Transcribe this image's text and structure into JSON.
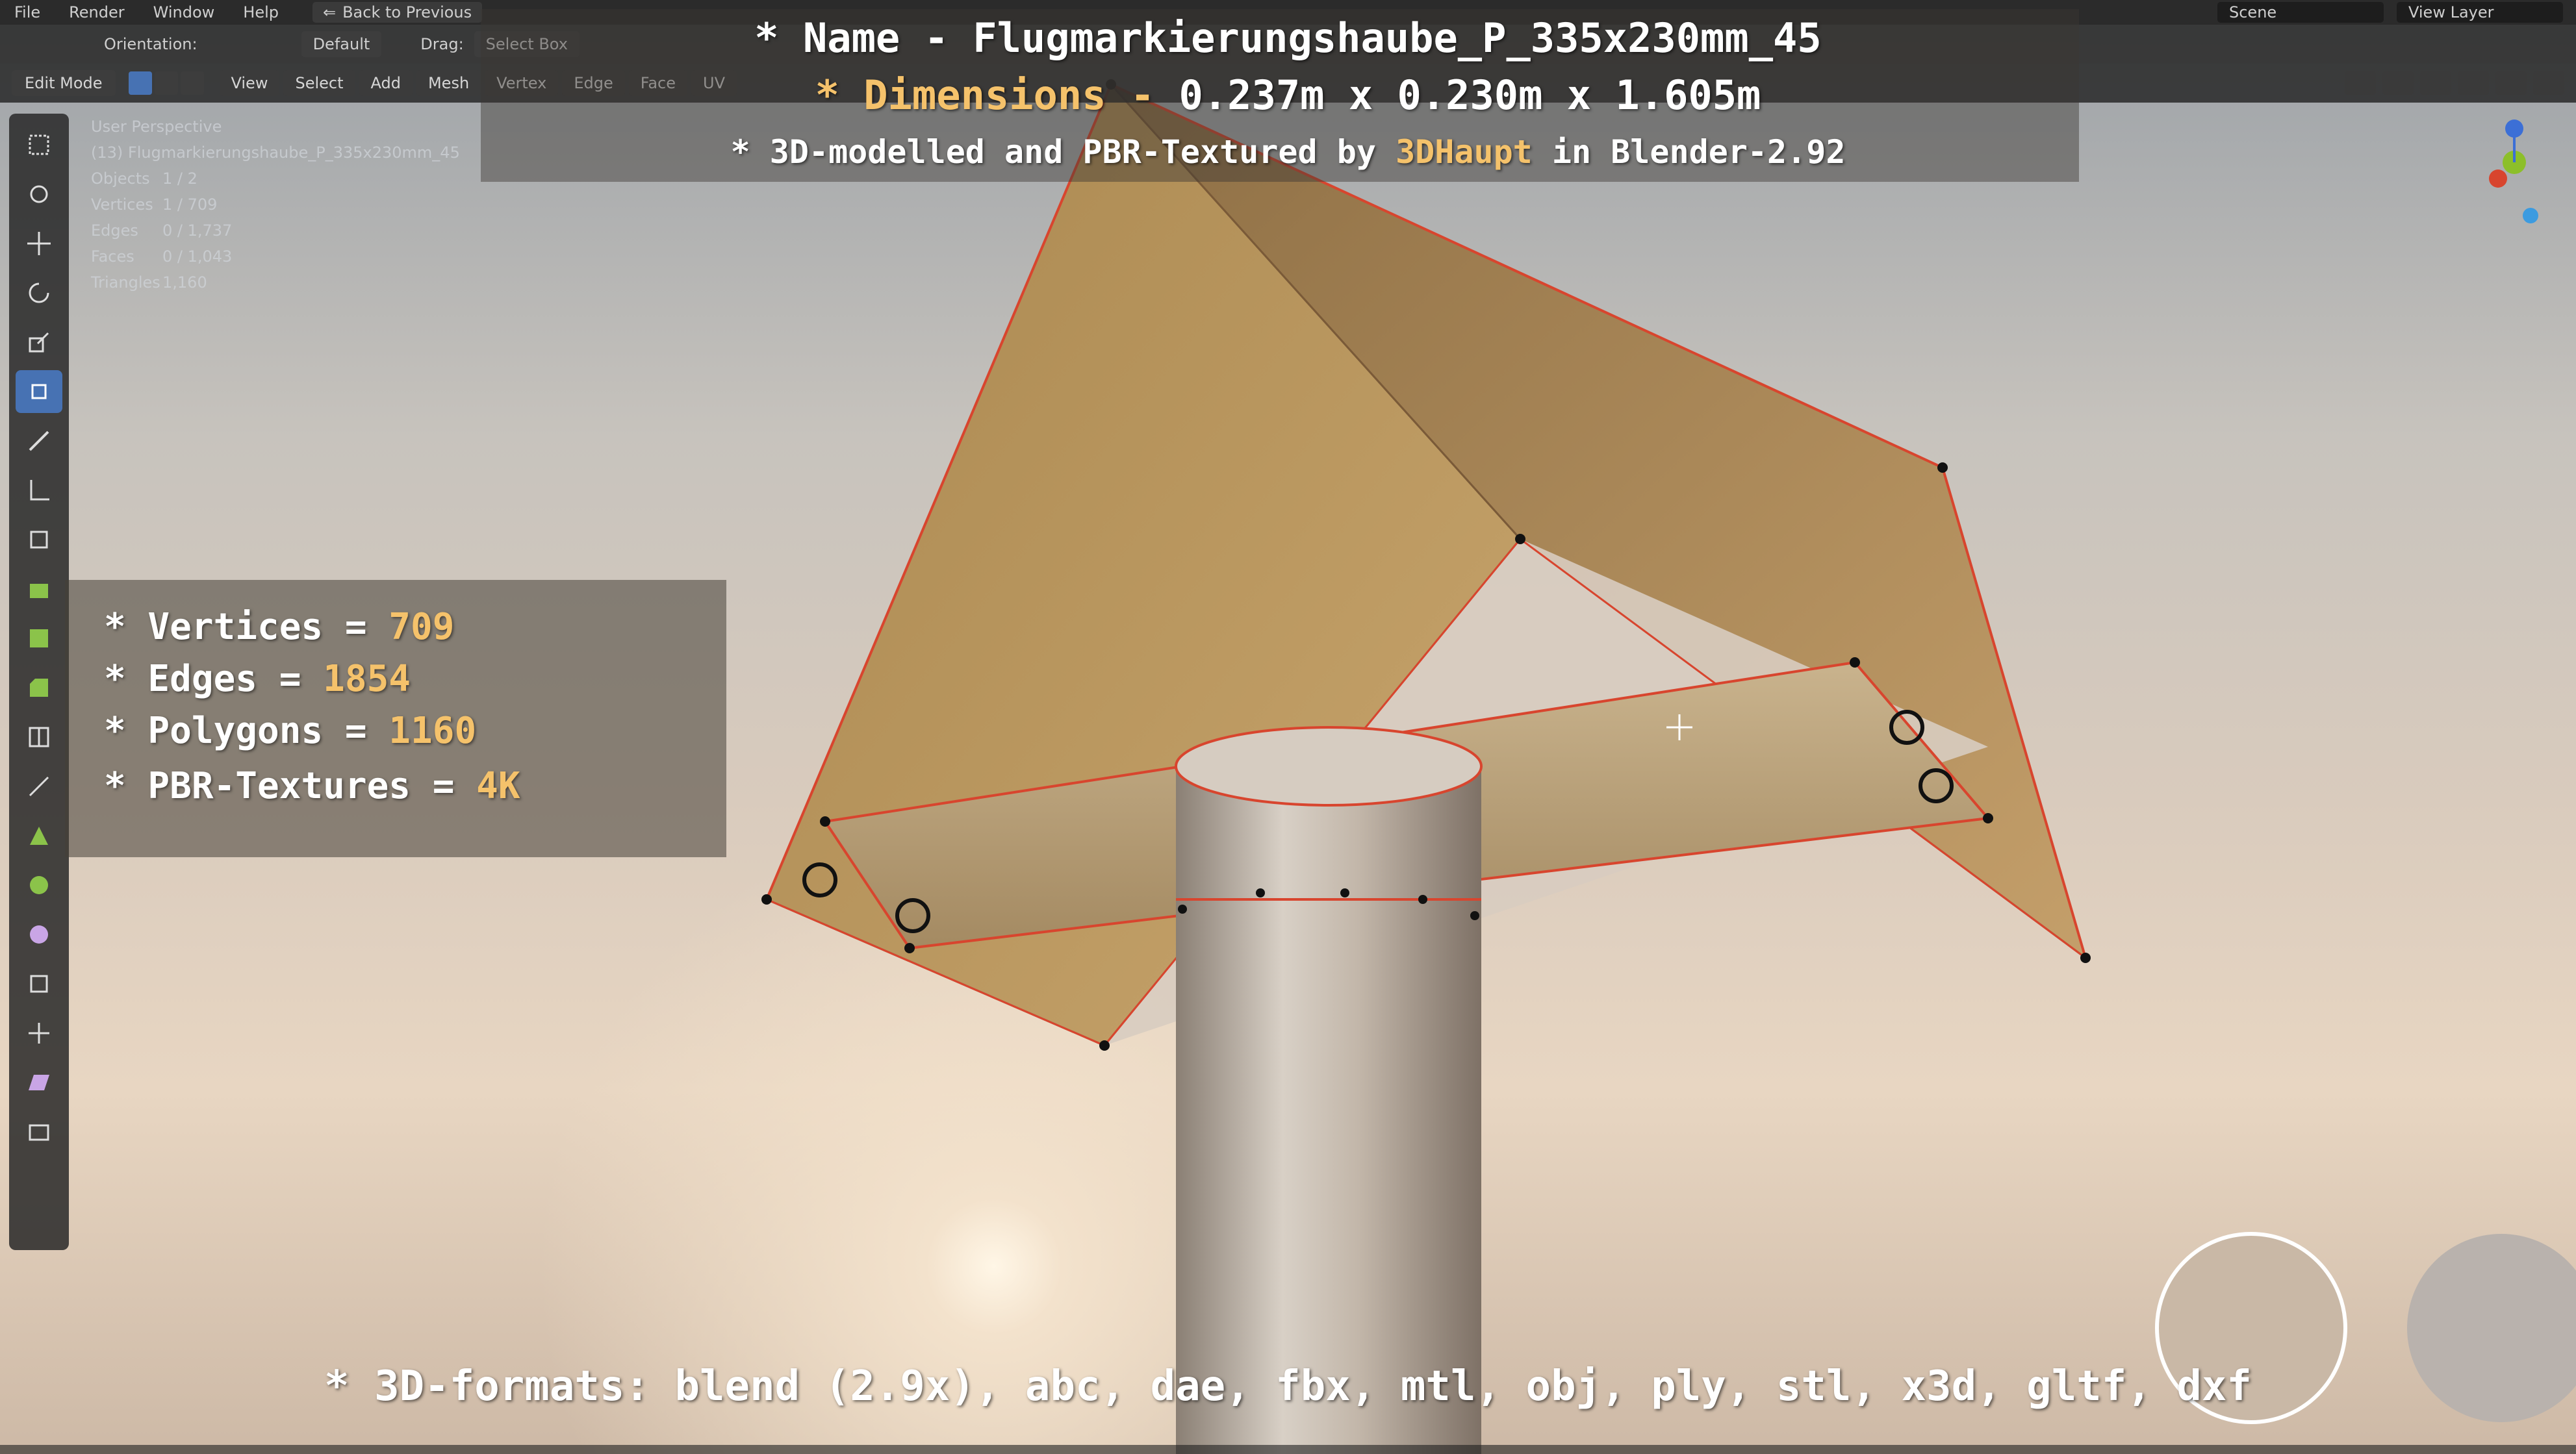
{
  "topbar": {
    "menus": [
      "File",
      "Render",
      "Window",
      "Help"
    ],
    "back_label": "Back to Previous",
    "scene_label": "Scene",
    "view_layer_label": "View Layer"
  },
  "subbar": {
    "orientation_label": "Orientation:",
    "pivot_label": "Default",
    "drag_label": "Drag:",
    "drag_value": "Select Box"
  },
  "header": {
    "mode": "Edit Mode",
    "menus": [
      "View",
      "Select",
      "Add",
      "Mesh",
      "Vertex",
      "Edge",
      "Face",
      "UV"
    ]
  },
  "viewinfo": {
    "perspective": "User Perspective",
    "object_name": "(13) Flugmarkierungshaube_P_335x230mm_45",
    "rows": [
      {
        "k": "Objects",
        "v": "1 / 2"
      },
      {
        "k": "Vertices",
        "v": "1 / 709"
      },
      {
        "k": "Edges",
        "v": "0 / 1,737"
      },
      {
        "k": "Faces",
        "v": "0 / 1,043"
      },
      {
        "k": "Triangles",
        "v": "1,160"
      }
    ]
  },
  "titles": {
    "name_line": "* Name - Flugmarkierungshaube_P_335x230mm_45",
    "dims_prefix": "* Dimensions -",
    "dims_value": "0.237m x 0.230m x 1.605m",
    "made_prefix": "* 3D-modelled and PBR-Textured by",
    "made_author": "3DHaupt",
    "made_suffix": "in Blender-2.92"
  },
  "stats": {
    "vertices_label": "* Vertices =",
    "vertices_value": "709",
    "edges_label": "* Edges =",
    "edges_value": "1854",
    "polygons_label": "* Polygons =",
    "polygons_value": "1160",
    "textures_label": "* PBR-Textures =",
    "textures_value": "4K"
  },
  "formats_line": "* 3D-formats: blend (2.9x), abc, dae, fbx, mtl, obj, ply, stl, x3d, gltf, dxf",
  "colors": {
    "accent_blue": "#4772b3",
    "highlight_orange": "#f5c26b",
    "edge_red": "#d8452e"
  }
}
